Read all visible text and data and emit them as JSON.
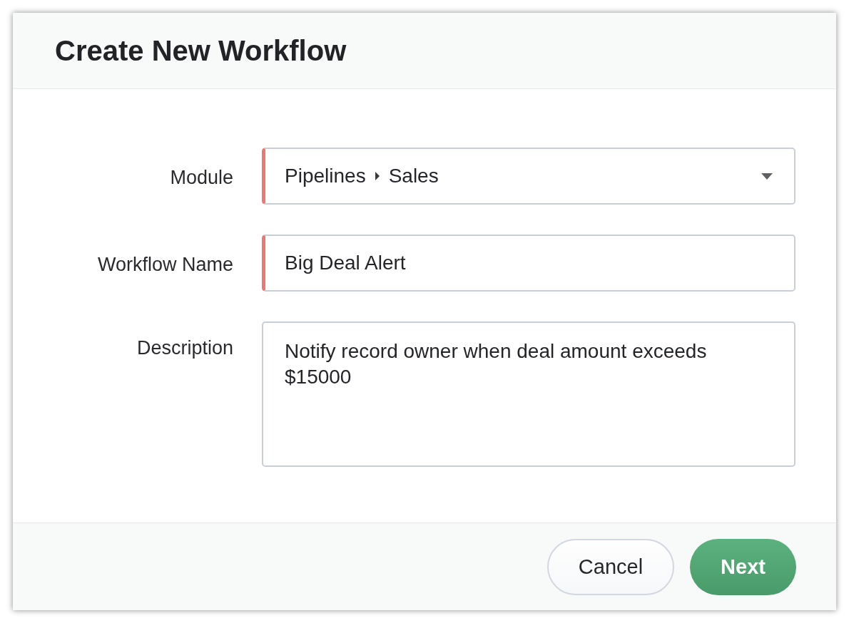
{
  "dialog": {
    "title": "Create New Workflow"
  },
  "fields": [
    {
      "kind": "select",
      "label": "Module",
      "required": true,
      "value": [
        "Pipelines",
        "Sales"
      ]
    },
    {
      "kind": "text",
      "label": "Workflow Name",
      "required": true,
      "value": "Big Deal Alert"
    },
    {
      "kind": "textarea",
      "label": "Description",
      "required": false,
      "value": "Notify record owner when deal amount exceeds $15000"
    }
  ],
  "buttons": [
    {
      "label": "Cancel",
      "kind": "secondary"
    },
    {
      "label": "Next",
      "kind": "primary"
    }
  ]
}
